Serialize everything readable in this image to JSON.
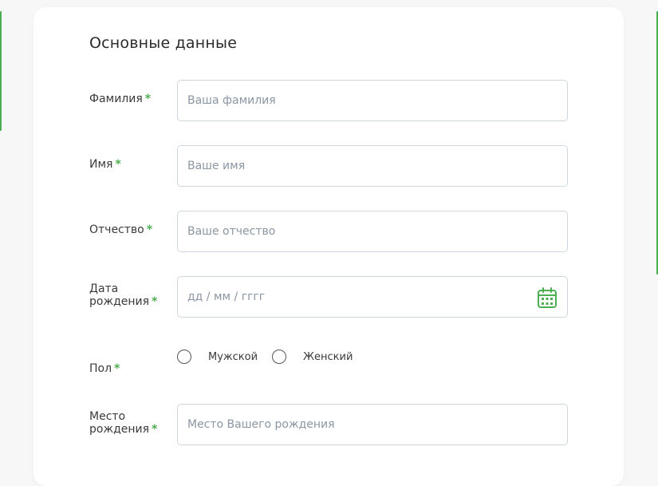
{
  "section": {
    "title": "Основные данные"
  },
  "fields": {
    "last_name": {
      "label": "Фамилия",
      "required_mark": "*",
      "placeholder": "Ваша фамилия"
    },
    "first_name": {
      "label": "Имя",
      "required_mark": "*",
      "placeholder": "Ваше имя"
    },
    "patronymic": {
      "label": "Отчество",
      "required_mark": "*",
      "placeholder": "Ваше отчество"
    },
    "birth_date": {
      "label_line1": "Дата",
      "label_line2": "рождения",
      "required_mark": "*",
      "placeholder": "дд / мм / гггг",
      "icon": "calendar-icon"
    },
    "gender": {
      "label": "Пол",
      "required_mark": "*",
      "options": [
        "Мужской",
        "Женский"
      ]
    },
    "birth_place": {
      "label_line1": "Место",
      "label_line2": "рождения",
      "required_mark": "*",
      "placeholder": "Место Вашего рождения"
    }
  },
  "colors": {
    "accent": "#4caf50",
    "input_border": "#cfd6dc",
    "placeholder": "#8a96a3"
  }
}
